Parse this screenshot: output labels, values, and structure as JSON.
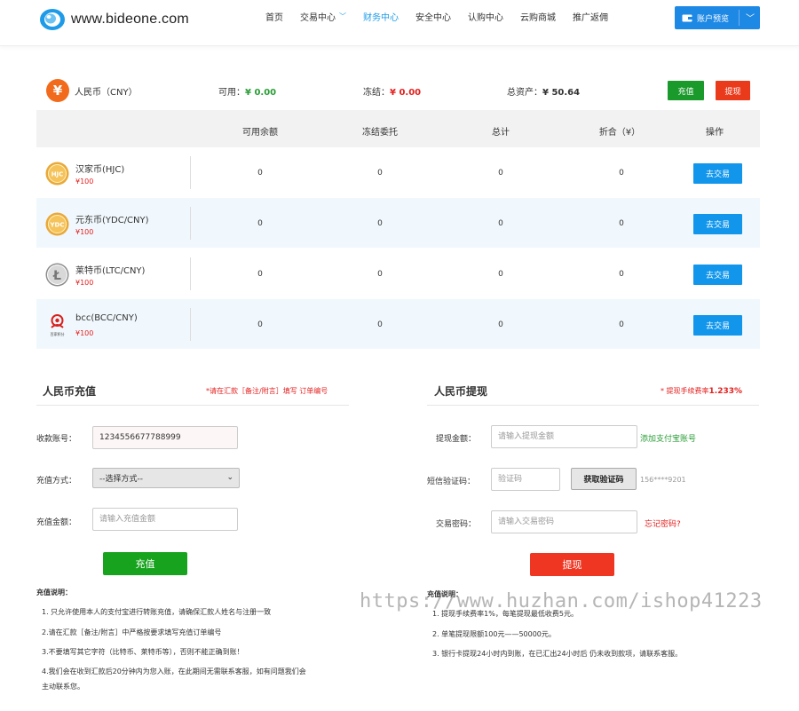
{
  "header": {
    "logo_text": "www.bideone.com",
    "nav": [
      {
        "label": "首页",
        "active": false,
        "dropdown": false
      },
      {
        "label": "交易中心",
        "active": false,
        "dropdown": true
      },
      {
        "label": "财务中心",
        "active": true,
        "dropdown": false
      },
      {
        "label": "安全中心",
        "active": false,
        "dropdown": false
      },
      {
        "label": "认购中心",
        "active": false,
        "dropdown": false
      },
      {
        "label": "云购商城",
        "active": false,
        "dropdown": false
      },
      {
        "label": "推广返佣",
        "active": false,
        "dropdown": false
      }
    ],
    "account_button": "账户预览",
    "dropdown_icon": "chevron-down-icon"
  },
  "cny": {
    "icon_glyph": "¥",
    "name": "人民币（CNY）",
    "available_label": "可用：",
    "available_value": "¥ 0.00",
    "frozen_label": "冻结：",
    "frozen_value": "¥ 0.00",
    "total_label": "总资产：",
    "total_value": "¥ 50.64",
    "recharge_button": "充值",
    "withdraw_button": "提现"
  },
  "table": {
    "headers": [
      "可用余额",
      "冻结委托",
      "总计",
      "折合（¥）",
      "操作"
    ],
    "rows": [
      {
        "name": "汉家币(HJC)",
        "price": "¥100",
        "icon": "hjc-coin-icon",
        "icon_text": "HJC",
        "available": "0",
        "frozen": "0",
        "total": "0",
        "converted": "0",
        "action": "去交易"
      },
      {
        "name": "元东币(YDC/CNY)",
        "price": "¥100",
        "icon": "ydc-coin-icon",
        "icon_text": "YDC",
        "available": "0",
        "frozen": "0",
        "total": "0",
        "converted": "0",
        "action": "去交易"
      },
      {
        "name": "莱特币(LTC/CNY)",
        "price": "¥100",
        "icon": "litecoin-icon",
        "icon_text": "Ł",
        "available": "0",
        "frozen": "0",
        "total": "0",
        "converted": "0",
        "action": "去交易"
      },
      {
        "name": "bcc(BCC/CNY)",
        "price": "¥100",
        "icon": "bcc-coin-icon",
        "icon_text": "百家积分",
        "available": "0",
        "frozen": "0",
        "total": "0",
        "converted": "0",
        "action": "去交易"
      }
    ]
  },
  "recharge": {
    "title": "人民币充值",
    "note": "*请在汇款［备注/附言］填写 订单编号",
    "account_label": "收款账号：",
    "account_value": "1234556677788999",
    "method_label": "充值方式：",
    "method_value": "--选择方式--",
    "amount_label": "充值金额：",
    "amount_placeholder": "请输入充值金额",
    "submit": "充值",
    "notes_title": "充值说明：",
    "notes": [
      "1. 只允许使用本人的支付宝进行转账充值，请确保汇款人姓名与注册一致",
      "2.请在汇款［备注/附言］中严格按要求填写充值订单编号",
      "3.不要填写其它字符（比特币、莱特币等），否则不能正确到账！",
      "4.我们会在收到汇款后20分钟内为您入账，在此期间无需联系客服，如有问题我们会",
      "主动联系您。"
    ]
  },
  "withdraw": {
    "title": "人民币提现",
    "note": "* 提现手续费率",
    "fee_rate": "1.233%",
    "amount_label": "提现金额：",
    "amount_placeholder": "请输入提现金额",
    "alipay_link": "添加支付宝账号",
    "sms_label": "短信验证码：",
    "sms_placeholder": "验证码",
    "sms_button": "获取验证码",
    "phone_masked": "156****9201",
    "password_label": "交易密码：",
    "password_placeholder": "请输入交易密码",
    "forgot_link": "忘记密码?",
    "submit": "提现",
    "notes_title": "充值说明：",
    "notes": [
      "1. 提现手续费率1%，每笔提现最低收费5元。",
      "2. 单笔提现限额100元——50000元。",
      "3. 银行卡提现24小时内到账，在已汇出24小时后 仍未收到款项，请联系客服。"
    ]
  },
  "watermark": "https://www.huzhan.com/ishop41223",
  "colors": {
    "accent_blue": "#1e88e5",
    "trade_blue": "#1296eb",
    "green": "#18a31f",
    "red": "#ee3623",
    "row_alt": "#f1f8fd"
  }
}
